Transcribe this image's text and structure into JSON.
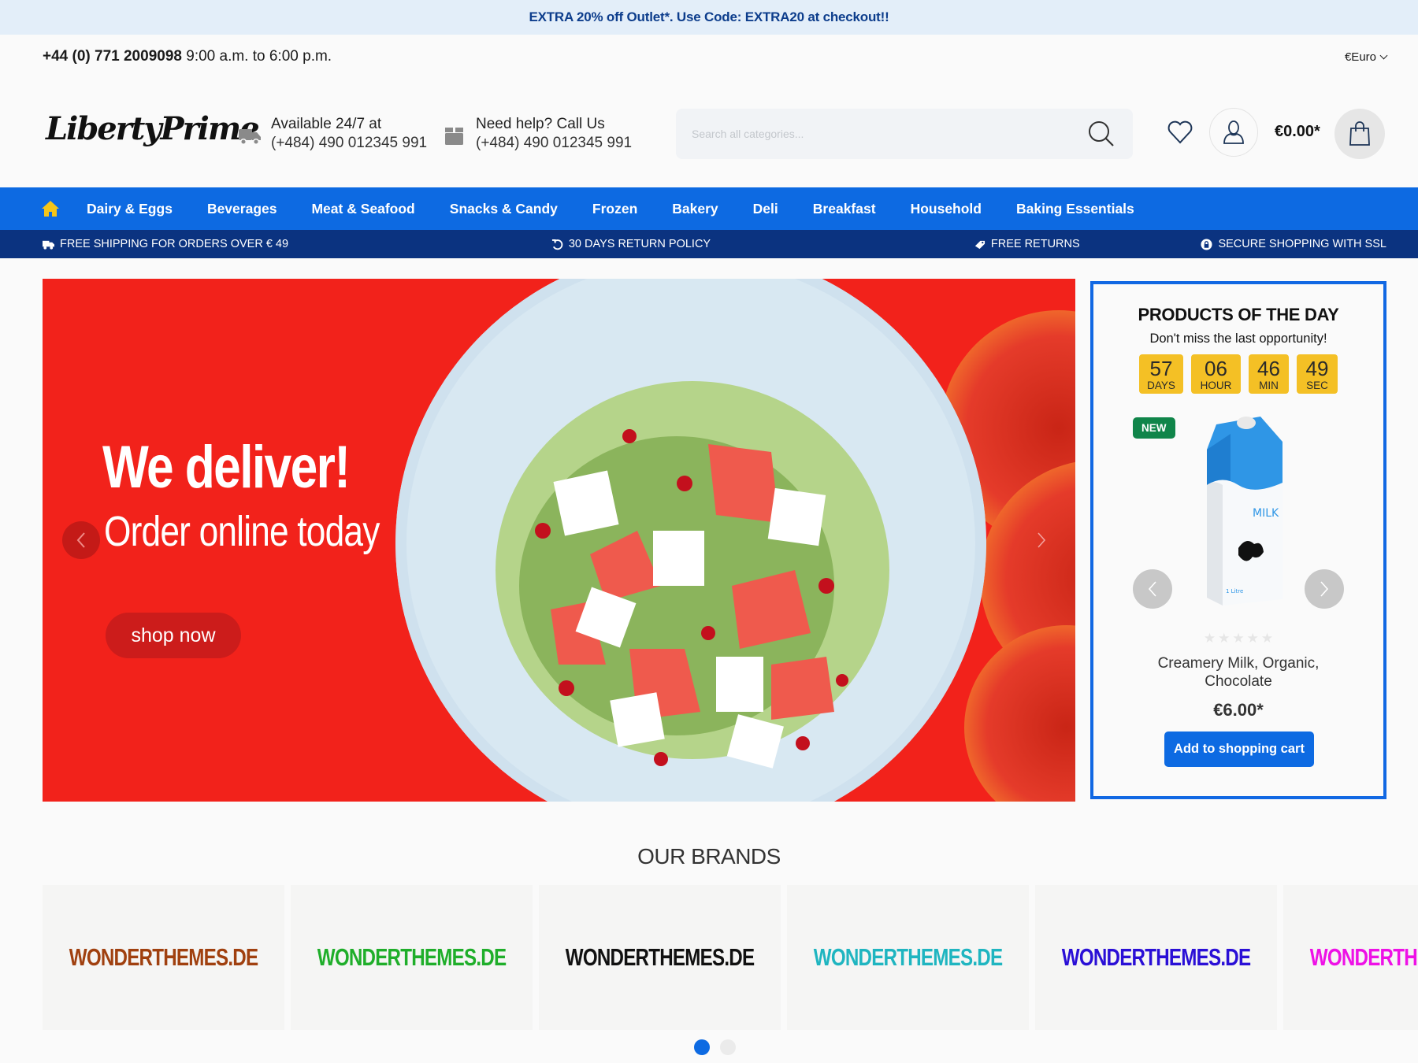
{
  "promo": {
    "text": "EXTRA 20% off Outlet*. Use Code: EXTRA20 at checkout!!"
  },
  "topbar": {
    "phone": "+44 (0) 771 2009098",
    "hours": "9:00 a.m. to 6:00 p.m.",
    "currency": "€Euro"
  },
  "header": {
    "logo": "LibertyPrime",
    "delivery": {
      "icon": "truck-icon",
      "line1": "Available 24/7 at",
      "line2": "(+484) 490 012345 991"
    },
    "help": {
      "icon": "box-icon",
      "line1": "Need help? Call Us",
      "line2": "(+484) 490 012345 991"
    },
    "search": {
      "placeholder": "Search all categories...",
      "value": ""
    },
    "cart_total": "€0.00*"
  },
  "nav": {
    "items": [
      {
        "label": "Dairy & Eggs"
      },
      {
        "label": "Beverages"
      },
      {
        "label": "Meat & Seafood"
      },
      {
        "label": "Snacks & Candy"
      },
      {
        "label": "Frozen"
      },
      {
        "label": "Bakery"
      },
      {
        "label": "Deli"
      },
      {
        "label": "Breakfast"
      },
      {
        "label": "Household"
      },
      {
        "label": "Baking Essentials"
      }
    ]
  },
  "usp": [
    {
      "icon": "truck-icon",
      "label": "FREE SHIPPING FOR ORDERS OVER € 49"
    },
    {
      "icon": "return-icon",
      "label": "30 DAYS RETURN POLICY"
    },
    {
      "icon": "tag-icon",
      "label": "FREE RETURNS"
    },
    {
      "icon": "lock-icon",
      "label": "SECURE SHOPPING WITH SSL"
    }
  ],
  "hero": {
    "headline": "We deliver!",
    "subline": "Order online today",
    "cta": "shop now"
  },
  "products_of_day": {
    "title": "PRODUCTS OF THE DAY",
    "subtitle": "Don't miss the last opportunity!",
    "countdown": [
      {
        "value": "57",
        "unit": "DAYS"
      },
      {
        "value": "06",
        "unit": "HOUR"
      },
      {
        "value": "46",
        "unit": "MIN"
      },
      {
        "value": "49",
        "unit": "SEC"
      }
    ],
    "product": {
      "badge": "NEW",
      "carton_label": "MILK",
      "carton_volume": "1 Litre",
      "rating": 0,
      "rating_max": 5,
      "name": "Creamery Milk, Organic, Chocolate",
      "price": "€6.00*",
      "add_to_cart": "Add to shopping cart"
    }
  },
  "brands": {
    "title": "OUR BRANDS",
    "items": [
      {
        "name": "WONDERTHEMES.DE",
        "color": "#a0400f"
      },
      {
        "name": "WONDERTHEMES.DE",
        "color": "#1fae2a"
      },
      {
        "name": "WONDERTHEMES.DE",
        "color": "#111111"
      },
      {
        "name": "WONDERTHEMES.DE",
        "color": "#1fb5c0"
      },
      {
        "name": "WONDERTHEMES.DE",
        "color": "#2a0fd6"
      },
      {
        "name": "WONDERTHEMES.DE",
        "color": "#ee11e6"
      }
    ],
    "pages": 2,
    "active_page": 1
  },
  "colors": {
    "primary": "#0d6ae2",
    "nav_dark": "#0b3380",
    "hero_red": "#f2221b",
    "timer_yellow": "#f4c025",
    "new_badge": "#10854a"
  }
}
